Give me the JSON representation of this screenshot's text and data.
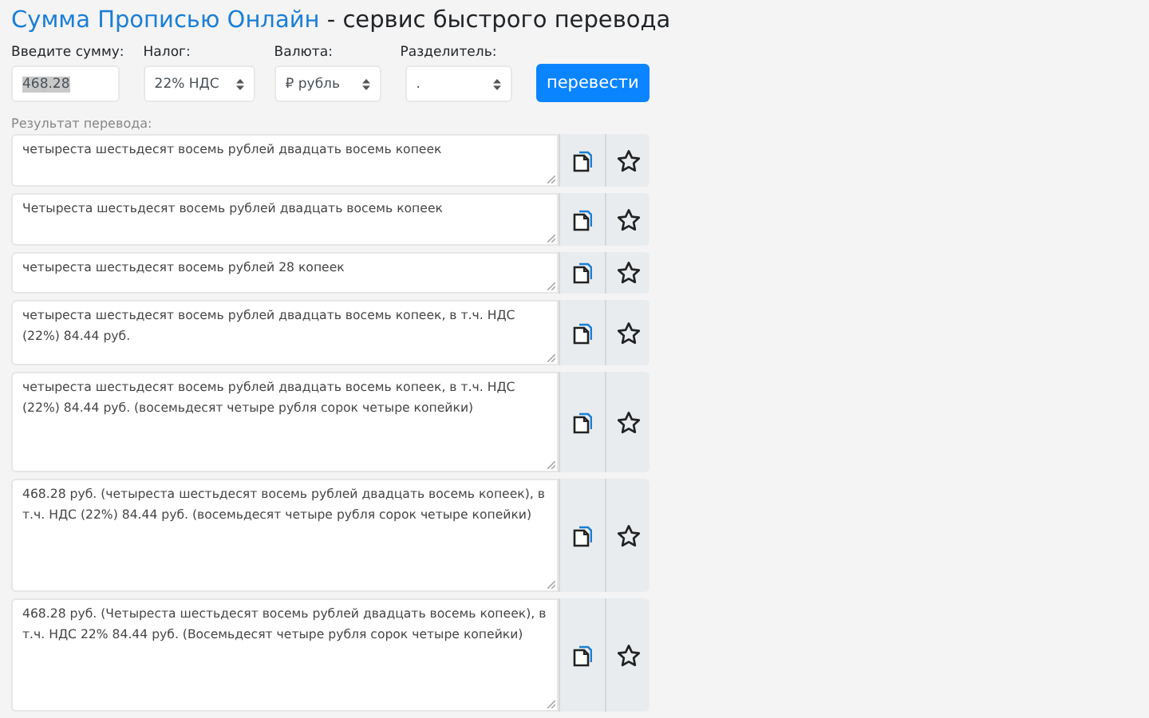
{
  "title": {
    "brand": "Сумма Прописью Онлайн",
    "rest": " - сервис быстрого перевода"
  },
  "form": {
    "amount": {
      "label": "Введите сумму:",
      "value": "468.28",
      "value_selected": true
    },
    "selects": [
      {
        "label": "Налог:",
        "value": "22% НДС"
      },
      {
        "label": "Валюта:",
        "value": "₽ рубль"
      },
      {
        "label": "Разделитель:",
        "value": "."
      }
    ],
    "submit": "перевести"
  },
  "result_label": "Результат перевода:",
  "results": [
    {
      "text": "четыреста шестьдесят восемь рублей двадцать восемь копеек"
    },
    {
      "text": "Четыреста шестьдесят восемь рублей двадцать восемь копеек"
    },
    {
      "text": "четыреста шестьдесят восемь рублей 28 копеек"
    },
    {
      "text": "четыреста шестьдесят восемь рублей двадцать восемь копеек, в т.ч. НДС (22%) 84.44 руб."
    },
    {
      "text": "четыреста шестьдесят восемь рублей двадцать восемь копеек, в т.ч. НДС (22%) 84.44 руб. (восемьдесят четыре рубля сорок четыре копейки)"
    },
    {
      "text": "468.28 руб. (четыреста шестьдесят восемь рублей двадцать восемь копеек), в т.ч. НДС (22%) 84.44 руб. (восемьдесят четыре рубля сорок четыре копейки)"
    },
    {
      "text": "468.28 руб. (Четыреста шестьдесят восемь рублей двадцать восемь копеек), в т.ч. НДС 22% 84.44 руб. (Восемьдесят четыре рубля сорок четыре копейки)"
    }
  ]
}
